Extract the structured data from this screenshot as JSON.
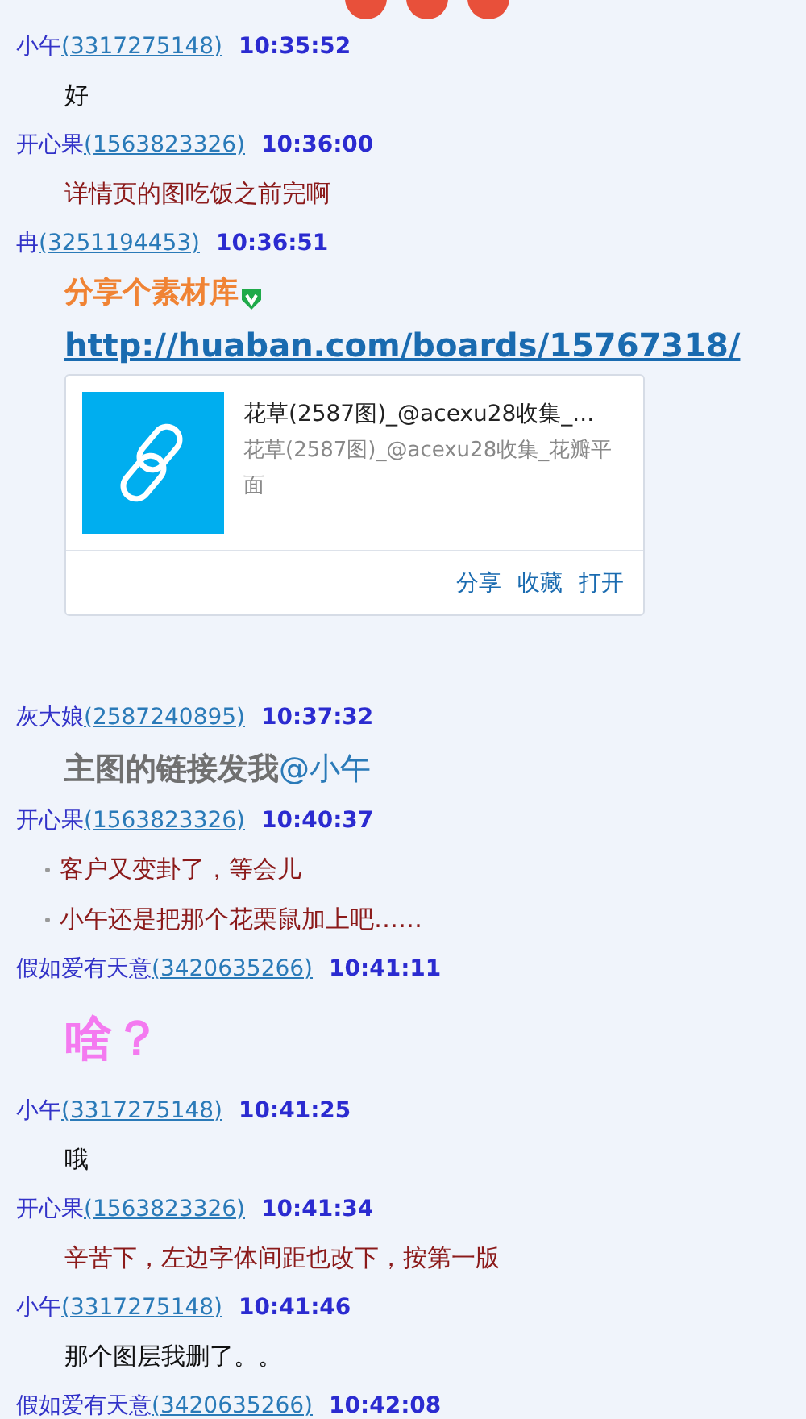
{
  "messages": [
    {
      "sender": "小午",
      "qq": "(3317275148)",
      "time": "10:35:52",
      "body": [
        {
          "kind": "text",
          "color": "#111111",
          "text": "好"
        }
      ]
    },
    {
      "sender": "开心果",
      "qq": "(1563823326)",
      "time": "10:36:00",
      "body": [
        {
          "kind": "text",
          "color": "#8b1a1a",
          "text": "详情页的图吃饭之前完啊"
        }
      ]
    },
    {
      "sender": "冉",
      "qq": "(3251194453)",
      "time": "10:36:51",
      "body": [
        {
          "kind": "headline",
          "color": "#f08334",
          "text": "分享个素材库"
        },
        {
          "kind": "link",
          "text": "http://huaban.com/boards/15767318/"
        },
        {
          "kind": "card",
          "title": "花草(2587图)_@acexu28收集_...",
          "description": "花草(2587图)_@acexu28收集_花瓣平面",
          "actions": [
            "分享",
            "收藏",
            "打开"
          ]
        }
      ]
    },
    {
      "sender": "灰大娘",
      "qq": "(2587240895)",
      "time": "10:37:32",
      "body": [
        {
          "kind": "large",
          "color": "#707070",
          "text": "主图的链接发我",
          "mention": "@小午"
        }
      ]
    },
    {
      "sender": "开心果",
      "qq": "(1563823326)",
      "time": "10:40:37",
      "body": [
        {
          "kind": "bullets",
          "color": "#8b1a1a",
          "items": [
            "客户又变卦了，等会儿",
            "小午还是把那个花栗鼠加上吧……"
          ]
        }
      ]
    },
    {
      "sender": "假如爱有天意",
      "qq": "(3420635266)",
      "time": "10:41:11",
      "body": [
        {
          "kind": "shout",
          "color": "#f47af0",
          "text": "啥？"
        }
      ]
    },
    {
      "sender": "小午",
      "qq": "(3317275148)",
      "time": "10:41:25",
      "body": [
        {
          "kind": "text",
          "color": "#111111",
          "text": "哦"
        }
      ]
    },
    {
      "sender": "开心果",
      "qq": "(1563823326)",
      "time": "10:41:34",
      "body": [
        {
          "kind": "text",
          "color": "#8b1a1a",
          "text": "辛苦下，左边字体间距也改下，按第一版"
        }
      ]
    },
    {
      "sender": "小午",
      "qq": "(3317275148)",
      "time": "10:41:46",
      "body": [
        {
          "kind": "text",
          "color": "#111111",
          "text": "那个图层我删了。。"
        }
      ]
    },
    {
      "sender": "假如爱有天意",
      "qq": "(3420635266)",
      "time": "10:42:08"
    }
  ]
}
